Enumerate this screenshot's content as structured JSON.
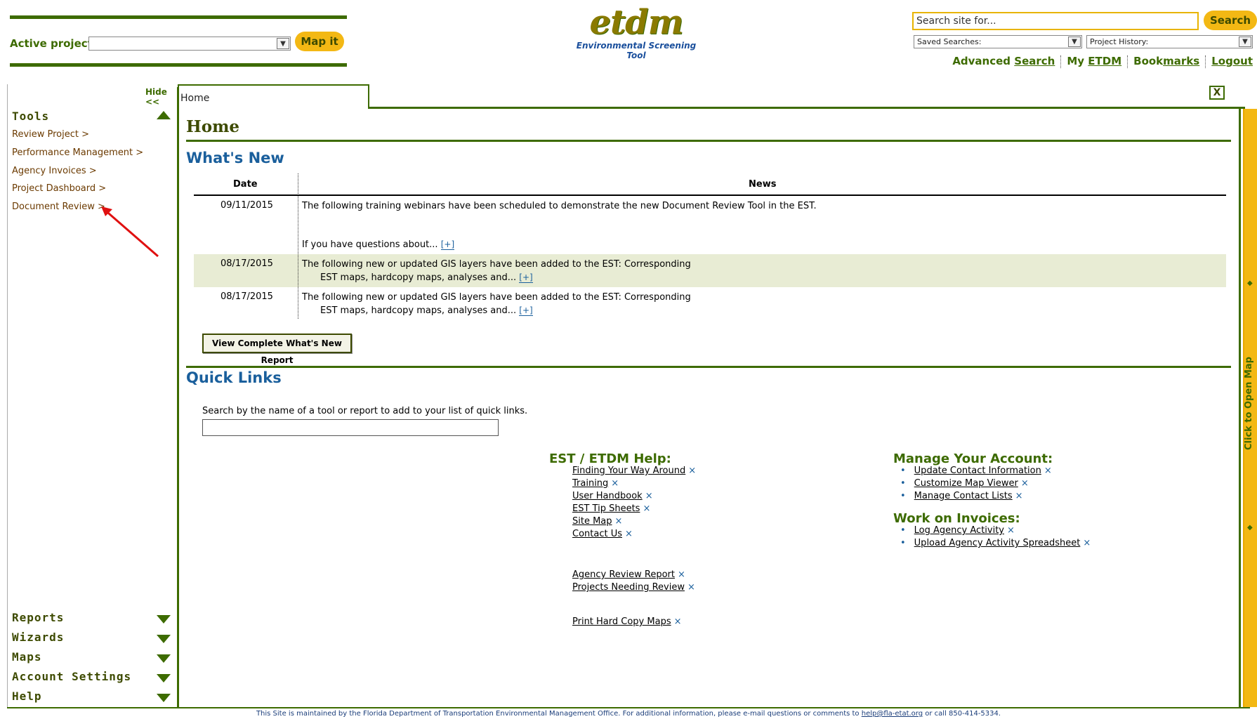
{
  "header": {
    "active_project_label": "Active project:",
    "map_it_label": "Map it",
    "logo_main": "etdm",
    "logo_sub": "Environmental Screening Tool",
    "search_placeholder": "Search site for...",
    "search_label": "Search",
    "saved_searches": "Saved Searches:",
    "project_history": "Project History:",
    "links": {
      "advanced_prefix": "Advanced ",
      "advanced_link": "Search",
      "my_prefix": "My ",
      "my_link": "ETDM",
      "bookmarks_prefix": "Book",
      "bookmarks_link": "marks",
      "logout": "Logout"
    }
  },
  "sidebar": {
    "hide_label": "Hide <<",
    "tools_title": "Tools",
    "tools": [
      "Review Project >",
      "Performance Management >",
      "Agency Invoices >",
      "Project Dashboard >",
      "Document Review >"
    ],
    "sections": [
      "Reports",
      "Wizards",
      "Maps",
      "Account Settings",
      "Help"
    ]
  },
  "tab": {
    "label": "Home",
    "close_label": "X"
  },
  "main": {
    "title": "Home",
    "whats_new": {
      "heading": "What's New",
      "col_date": "Date",
      "col_news": "News",
      "rows": [
        {
          "date": "09/11/2015",
          "line1": "The following training webinars have been scheduled to demonstrate the new Document Review Tool in the EST.",
          "line2": "If you have questions about...",
          "expand": "[+]"
        },
        {
          "date": "08/17/2015",
          "line1": "The following new or updated GIS layers have been added to the EST: Corresponding",
          "line2": "EST maps, hardcopy maps, analyses and...",
          "expand": "[+]"
        },
        {
          "date": "08/17/2015",
          "line1": "The following new or updated GIS layers have been added to the EST: Corresponding",
          "line2": "EST maps, hardcopy maps, analyses and...",
          "expand": "[+]"
        }
      ],
      "report_button": "View Complete What's New Report"
    },
    "quick_links": {
      "heading": "Quick Links",
      "instruction": "Search by the name of a tool or report to add to your list of quick links.",
      "help_heading": "EST / ETDM Help:",
      "help_links": [
        "Finding Your Way Around",
        "Training",
        "User Handbook",
        "EST Tip Sheets",
        "Site Map",
        "Contact Us"
      ],
      "review_links": [
        "Agency Review Report",
        "Projects Needing Review"
      ],
      "map_links": [
        "Print Hard Copy Maps"
      ],
      "account_heading": "Manage Your Account:",
      "account_links": [
        "Update Contact Information",
        "Customize Map Viewer",
        "Manage Contact Lists"
      ],
      "invoices_heading": "Work on Invoices:",
      "invoice_links": [
        "Log Agency Activity",
        "Upload Agency Activity Spreadsheet"
      ],
      "remove_glyph": "×",
      "bullet_glyph": "•"
    }
  },
  "right_strip": {
    "label": "Click to Open Map",
    "arrow_glyph": "◆"
  },
  "footer": {
    "text_before": "This Site is maintained by the Florida Department of Transportation Environmental Management Office. For additional information, please e-mail questions or comments to ",
    "email": "help@fla-etat.org",
    "text_after": " or call 850-414-5334."
  },
  "colors": {
    "brand_green": "#3d6b00",
    "accent_yellow": "#f3b814",
    "link_blue": "#1a5f9c",
    "tool_brown": "#6b3a00"
  }
}
